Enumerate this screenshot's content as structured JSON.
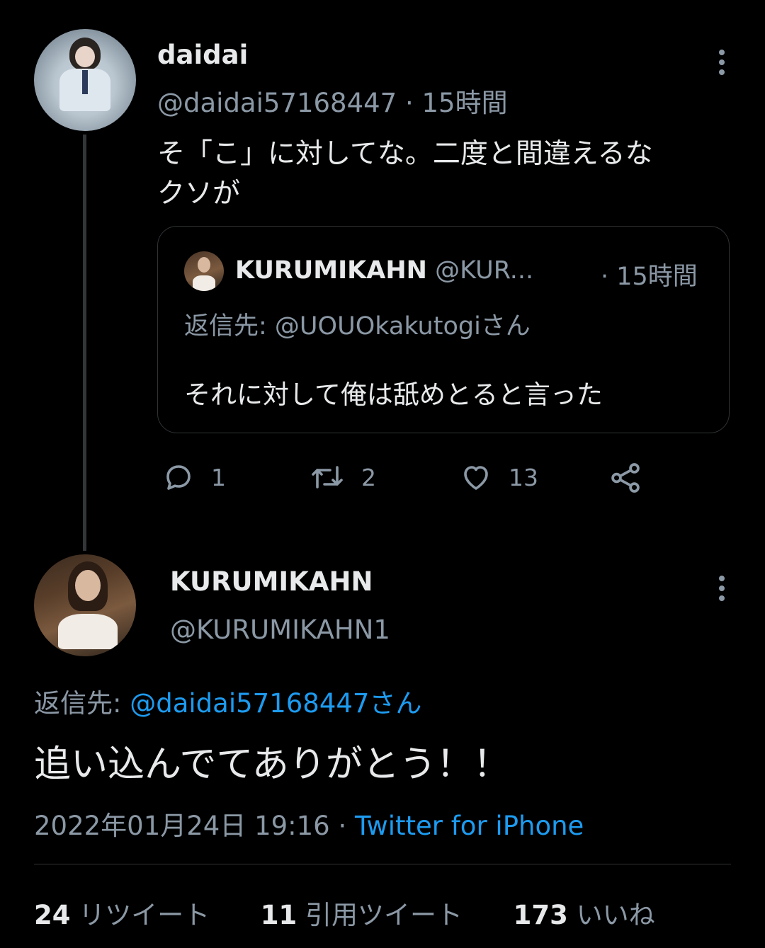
{
  "tweet1": {
    "display_name": "daidai",
    "handle": "@daidai57168447",
    "separator": " · ",
    "time": "15時間",
    "text_line1": "そ「こ」に対してな。二度と間違えるな",
    "text_line2": "クソが",
    "quote": {
      "display_name": "KURUMIKAHN",
      "handle_truncated": "@KUR...",
      "time": "· 15時間",
      "reply_prefix": "返信先: ",
      "reply_to": "@UOUOkakutogiさん",
      "text": "それに対して俺は舐めとると言った"
    },
    "actions": {
      "replies": "1",
      "retweets": "2",
      "likes": "13"
    }
  },
  "tweet2": {
    "display_name": "KURUMIKAHN",
    "handle": "@KURUMIKAHN1",
    "reply_prefix": "返信先: ",
    "reply_to": "@daidai57168447さん",
    "text": "追い込んでてありがとう！！",
    "timestamp": "2022年01月24日 19:16",
    "separator": " · ",
    "source": "Twitter for iPhone",
    "stats": {
      "retweets_count": "24",
      "retweets_label": " リツイート",
      "quotes_count": "11",
      "quotes_label": " 引用ツイート",
      "likes_count": "173",
      "likes_label": " いいね"
    }
  },
  "icons": {
    "more": "more-vertical-icon",
    "reply": "reply-icon",
    "retweet": "retweet-icon",
    "like": "heart-icon",
    "share": "share-icon"
  },
  "colors": {
    "background": "#000000",
    "text": "#e7e9ea",
    "muted": "#8b98a5",
    "accent": "#1d9bf0",
    "border": "#2f3336"
  }
}
